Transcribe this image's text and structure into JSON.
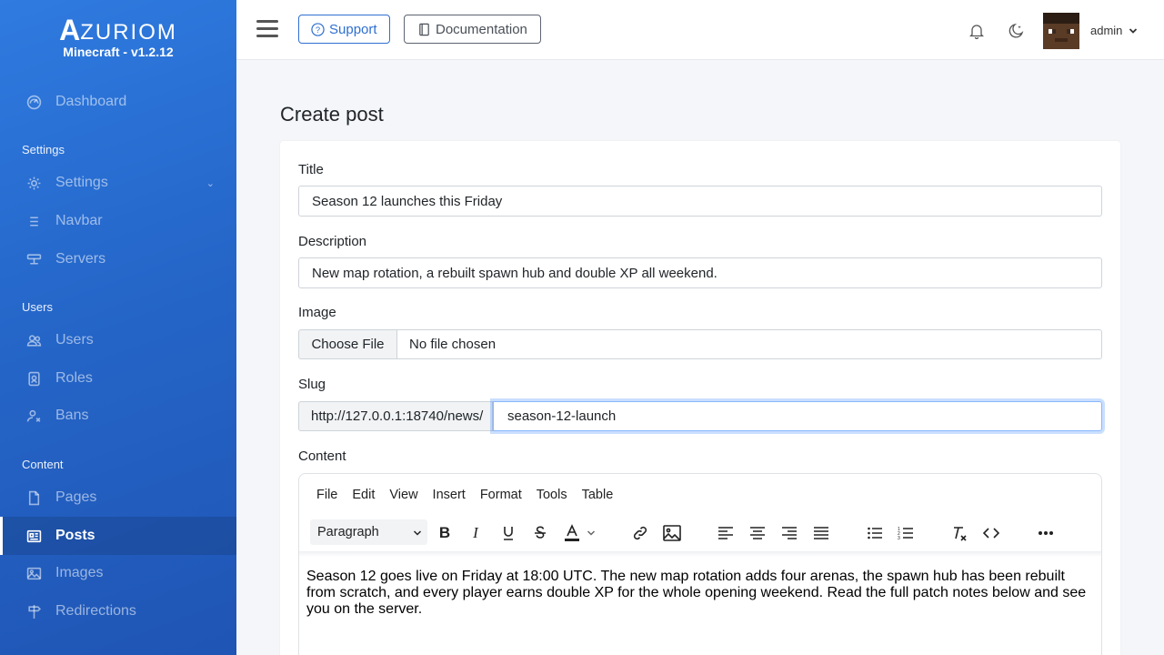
{
  "brand": {
    "logo_initial": "A",
    "logo_rest": "ZURIOM",
    "subtitle": "Minecraft - v1.2.12"
  },
  "sidebar": {
    "dashboard": "Dashboard",
    "sections": [
      {
        "heading": "Settings",
        "items": [
          "Settings",
          "Navbar",
          "Servers"
        ]
      },
      {
        "heading": "Users",
        "items": [
          "Users",
          "Roles",
          "Bans"
        ]
      },
      {
        "heading": "Content",
        "items": [
          "Pages",
          "Posts",
          "Images",
          "Redirections"
        ]
      }
    ],
    "active_item": "Posts",
    "labels": {
      "settings_heading": "Settings",
      "settings": "Settings",
      "navbar": "Navbar",
      "servers": "Servers",
      "users_heading": "Users",
      "users": "Users",
      "roles": "Roles",
      "bans": "Bans",
      "content_heading": "Content",
      "pages": "Pages",
      "posts": "Posts",
      "images": "Images",
      "redirections": "Redirections"
    }
  },
  "topbar": {
    "support_label": "Support",
    "documentation_label": "Documentation",
    "user_name": "admin"
  },
  "page": {
    "title": "Create post"
  },
  "form": {
    "title_label": "Title",
    "title_value": "Season 12 launches this Friday",
    "description_label": "Description",
    "description_value": "New map rotation, a rebuilt spawn hub and double XP all weekend.",
    "image_label": "Image",
    "file_button": "Choose File",
    "file_status": "No file chosen",
    "slug_label": "Slug",
    "slug_prefix": "http://127.0.0.1:18740/news/",
    "slug_value": "season-12-launch",
    "content_label": "Content"
  },
  "editor": {
    "menu": [
      "File",
      "Edit",
      "View",
      "Insert",
      "Format",
      "Tools",
      "Table"
    ],
    "menu_file": "File",
    "menu_edit": "Edit",
    "menu_view": "View",
    "menu_insert": "Insert",
    "menu_format": "Format",
    "menu_tools": "Tools",
    "menu_table": "Table",
    "block_format": "Paragraph",
    "body_text": "Season 12 goes live on Friday at 18:00 UTC. The new map rotation adds four arenas, the spawn hub has been rebuilt from scratch, and every player earns double XP for the whole opening weekend. Read the full patch notes below and see you on the server."
  },
  "colors": {
    "sidebar": "#2566c9",
    "accent": "#2f6fd0",
    "focus": "#86b7fe"
  }
}
